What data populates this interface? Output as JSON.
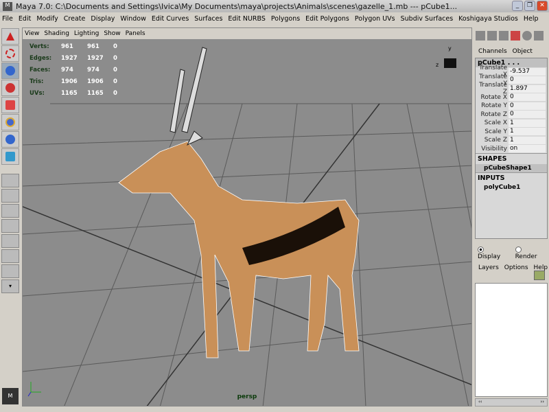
{
  "window": {
    "title": "Maya 7.0: C:\\Documents and Settings\\Ivica\\My Documents\\maya\\projects\\Animals\\scenes\\gazelle_1.mb  ---  pCube1...",
    "logo": "M"
  },
  "menu": [
    "File",
    "Edit",
    "Modify",
    "Create",
    "Display",
    "Window",
    "Edit Curves",
    "Surfaces",
    "Edit NURBS",
    "Polygons",
    "Edit Polygons",
    "Polygon UVs",
    "Subdiv Surfaces",
    "Koshigaya Studios",
    "Help"
  ],
  "panel_menu": [
    "View",
    "Shading",
    "Lighting",
    "Show",
    "Panels"
  ],
  "stats": [
    {
      "label": "Verts:",
      "a": "961",
      "b": "961",
      "c": "0"
    },
    {
      "label": "Edges:",
      "a": "1927",
      "b": "1927",
      "c": "0"
    },
    {
      "label": "Faces:",
      "a": "974",
      "b": "974",
      "c": "0"
    },
    {
      "label": "Tris:",
      "a": "1906",
      "b": "1906",
      "c": "0"
    },
    {
      "label": "UVs:",
      "a": "1165",
      "b": "1165",
      "c": "0"
    }
  ],
  "camera": "persp",
  "channel_box": {
    "tabs": [
      "Channels",
      "Object"
    ],
    "object": "pCube1 . . .",
    "channels": [
      {
        "name": "Translate X",
        "value": "-9.537"
      },
      {
        "name": "Translate Y",
        "value": "0"
      },
      {
        "name": "Translate Z",
        "value": "1.897"
      },
      {
        "name": "Rotate X",
        "value": "0"
      },
      {
        "name": "Rotate Y",
        "value": "0"
      },
      {
        "name": "Rotate Z",
        "value": "0"
      },
      {
        "name": "Scale X",
        "value": "1"
      },
      {
        "name": "Scale Y",
        "value": "1"
      },
      {
        "name": "Scale Z",
        "value": "1"
      },
      {
        "name": "Visibility",
        "value": "on"
      }
    ],
    "shapes_label": "SHAPES",
    "shape": "pCubeShape1",
    "inputs_label": "INPUTS",
    "input": "polyCube1"
  },
  "layer_editor": {
    "display": "Display",
    "render": "Render",
    "selected": "Display",
    "menu": [
      "Layers",
      "Options",
      "Help"
    ]
  },
  "logo_bottom": "M"
}
